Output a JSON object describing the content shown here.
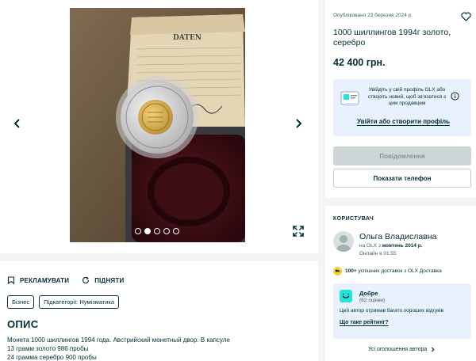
{
  "gallery": {
    "photo_alt": "coin",
    "dots_count": 5,
    "active_dot": 1,
    "certificate_heading": "DATEN"
  },
  "description": {
    "promote_label": "РЕКЛАМУВАТИ",
    "raise_label": "ПІДНЯТИ",
    "tags": [
      "Бізнес",
      "Підкатегорії: Нумізматика"
    ],
    "title": "ОПИС",
    "lines": [
      "Монета 1000 шиллингов 1994 года. Австрийский монетный двор. В капсуле",
      "13 грамм золото 986 пробы",
      "24 грамма серебро 900 пробы"
    ]
  },
  "listing": {
    "published": "Опубліковано 23 березня 2024 р.",
    "title": "1000 шиллингов 1994г золото, серебро",
    "price": "42 400 грн.",
    "prompt_text": "Увійдіть у свій профіль OLX або створіть новий, щоб зв'язатися з цим продавцем",
    "prompt_link": "Увійти або створити профіль",
    "message_button": "Повідомлення",
    "phone_button": "Показати телефон"
  },
  "user": {
    "heading": "КОРИСТУВАЧ",
    "name": "Ольга Владиславна",
    "since_prefix": "на OLX з ",
    "since_value": "жовтень 2014 р.",
    "online": "Онлайн в 01:55",
    "deliveries_bold": "100+",
    "deliveries_text": " успішних доставок з OLX Доставка",
    "rating_title": "Добре",
    "rating_count": "(62 оцінки)",
    "rating_desc": "Цей автор отримав багато хороших відгуків",
    "rating_link": "Що таке рейтинг?",
    "all_ads": "Усі оголошення автора"
  },
  "colors": {
    "primary": "#002f34",
    "accent_bg": "#e8f1fd",
    "disabled_btn": "#cdd5d6",
    "rating_icon": "#23e5db",
    "delivery_icon": "#ffce32"
  },
  "icons": [
    "chevron-left-icon",
    "chevron-right-icon",
    "expand-icon",
    "heart-icon",
    "info-icon",
    "megaphone-icon",
    "refresh-icon",
    "delivery-icon",
    "smile-icon",
    "chevron-right-small-icon"
  ]
}
